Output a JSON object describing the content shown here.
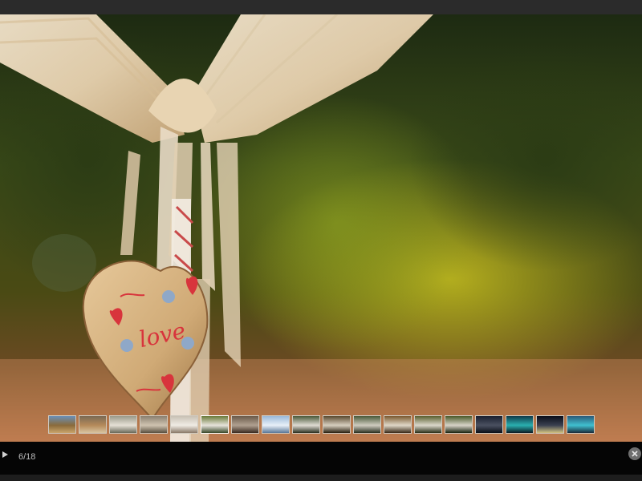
{
  "viewer": {
    "counter": "6/18",
    "current_index": 6,
    "total": 18
  },
  "icons": {
    "play": "play-icon",
    "close": "close-icon"
  },
  "photo": {
    "heart_text": "love"
  },
  "thumbnails": [
    {
      "colors": [
        "#6a90b8",
        "#8a6a3a",
        "#c9a36a"
      ]
    },
    {
      "colors": [
        "#7a6a55",
        "#b58a5a",
        "#d8c3a0"
      ]
    },
    {
      "colors": [
        "#9a9a8a",
        "#e6e0d6",
        "#6a6a5a"
      ]
    },
    {
      "colors": [
        "#8a8070",
        "#cfc3b0",
        "#5a5040"
      ]
    },
    {
      "colors": [
        "#c8c0b4",
        "#f0ece4",
        "#8a7a6a"
      ]
    },
    {
      "colors": [
        "#6a7a3a",
        "#e8e4dc",
        "#3a4a2a"
      ]
    },
    {
      "colors": [
        "#6a5a4a",
        "#b0a090",
        "#3a2a20"
      ]
    },
    {
      "colors": [
        "#9ab8d8",
        "#e8f0f8",
        "#5a7898"
      ]
    },
    {
      "colors": [
        "#4a5a3a",
        "#e0dcd4",
        "#2a3020"
      ]
    },
    {
      "colors": [
        "#5a4a30",
        "#d8d0c0",
        "#2a2010"
      ]
    },
    {
      "colors": [
        "#4a5a3a",
        "#d0ccc0",
        "#2a3020"
      ]
    },
    {
      "colors": [
        "#7a5a30",
        "#e0d8c8",
        "#3a2a18"
      ]
    },
    {
      "colors": [
        "#5a6030",
        "#dcd8cc",
        "#2a3018"
      ]
    },
    {
      "colors": [
        "#4a5a2a",
        "#d8d4c8",
        "#1a2410"
      ]
    },
    {
      "colors": [
        "#1a2030",
        "#4a5060",
        "#0a0e18"
      ]
    },
    {
      "colors": [
        "#0f3a4a",
        "#2ab0b0",
        "#0a1a24"
      ]
    },
    {
      "colors": [
        "#0a0e1a",
        "#3a4050",
        "#d0c080"
      ]
    },
    {
      "colors": [
        "#2a5a7a",
        "#40c0d0",
        "#1a2a3a"
      ]
    }
  ]
}
